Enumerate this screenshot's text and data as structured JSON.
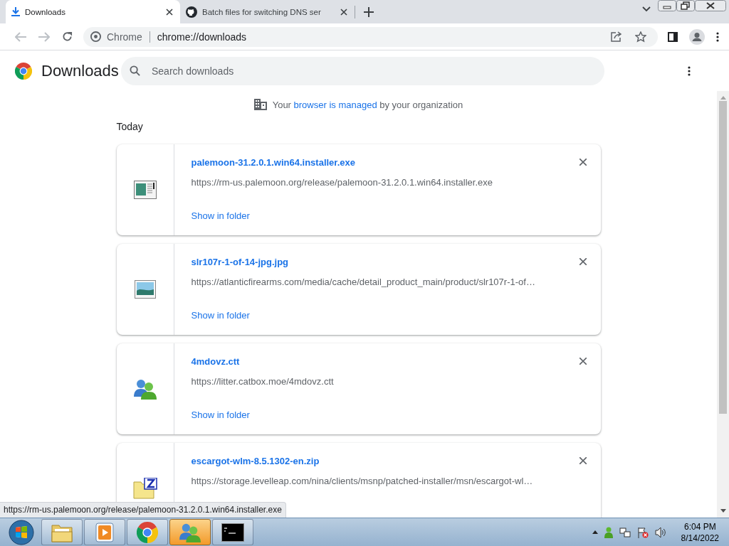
{
  "tabs": [
    {
      "title": "Downloads",
      "kind": "download",
      "selected": true
    },
    {
      "title": "Batch files for switching DNS ser",
      "kind": "github",
      "selected": false
    }
  ],
  "address": {
    "site_label": "Chrome",
    "url": "chrome://downloads"
  },
  "page": {
    "title": "Downloads",
    "search": {
      "placeholder": "Search downloads"
    },
    "managed_notice": {
      "before": "Your ",
      "link": "browser is managed",
      "after": " by your organization"
    },
    "section": "Today"
  },
  "downloads": [
    {
      "kind": "exe",
      "name": "palemoon-31.2.0.1.win64.installer.exe",
      "url": "https://rm-us.palemoon.org/release/palemoon-31.2.0.1.win64.installer.exe",
      "action": "Show in folder"
    },
    {
      "kind": "image",
      "name": "slr107r-1-of-14-jpg.jpg",
      "url": "https://atlanticfirearms.com/media/cache/detail_product_main/product/slr107r-1-of…",
      "action": "Show in folder"
    },
    {
      "kind": "contacts",
      "name": "4mdovz.ctt",
      "url": "https://litter.catbox.moe/4mdovz.ctt",
      "action": "Show in folder"
    },
    {
      "kind": "zip",
      "name": "escargot-wlm-8.5.1302-en.zip",
      "url": "https://storage.levelleap.com/nina/clients/msnp/patched-installer/msn/escargot-wl…"
    }
  ],
  "status_url": "https://rm-us.palemoon.org/release/palemoon-31.2.0.1.win64.installer.exe",
  "taskbar": {
    "items": [
      {
        "kind": "explorer",
        "selected": false
      },
      {
        "kind": "media",
        "selected": false
      },
      {
        "kind": "chrome",
        "selected": false
      },
      {
        "kind": "contacts",
        "selected": true
      },
      {
        "kind": "console",
        "selected": false
      }
    ],
    "time": "6:04 PM",
    "date": "8/14/2022"
  }
}
